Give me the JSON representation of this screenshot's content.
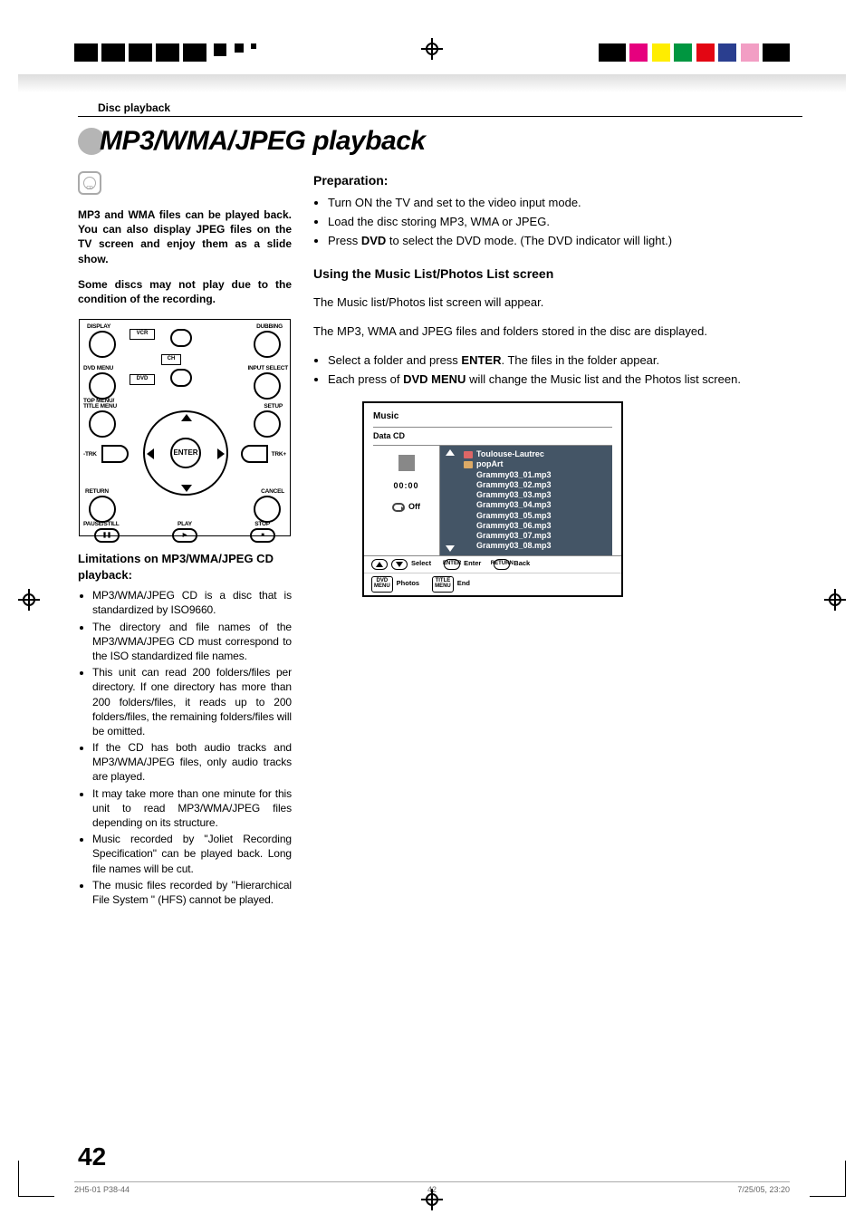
{
  "breadcrumb": "Disc playback",
  "title": "MP3/WMA/JPEG playback",
  "cd_badge": "CD",
  "left": {
    "intro1": "MP3 and WMA files can be played back. You can also display JPEG files on the TV screen and enjoy them as a slide show.",
    "intro2": "Some discs may not play due to the condition of the recording.",
    "remote": {
      "display": "DISPLAY",
      "dubbing": "DUBBING",
      "vcr": "VCR",
      "dvd": "DVD",
      "dvd_menu": "DVD MENU",
      "ch": "CH",
      "input_select": "INPUT SELECT",
      "top_menu": "TOP MENU/",
      "title_menu": "TITLE MENU",
      "setup": "SETUP",
      "trk_minus": "-TRK",
      "trk_plus": "TRK+",
      "enter": "ENTER",
      "return": "RETURN",
      "cancel": "CANCEL",
      "pause": "PAUSE/STILL",
      "play": "PLAY",
      "stop": "STOP"
    },
    "limitations_h": "Limitations on MP3/WMA/JPEG CD playback:",
    "limitations": [
      "MP3/WMA/JPEG CD is a disc that is standardized by ISO9660.",
      "The directory and file names of the MP3/WMA/JPEG CD must correspond to the ISO standardized file names.",
      "This unit can read 200 folders/files per directory. If one directory has more than 200 folders/files, it reads up to 200 folders/files, the remaining folders/files will be omitted.",
      "If the CD has both audio tracks and MP3/WMA/JPEG files, only audio tracks are played.",
      "It may take more than one minute for this unit to read MP3/WMA/JPEG files depending on its structure.",
      "Music recorded by \"Joliet Recording Specification\" can be played back. Long file names will be cut.",
      "The music files recorded by \"Hierarchical File System \" (HFS) cannot be played."
    ]
  },
  "right": {
    "prep_h": "Preparation:",
    "prep": [
      "Turn ON the TV and set to the video input mode.",
      "Load the disc storing MP3, WMA or JPEG."
    ],
    "prep3_a": "Press ",
    "prep3_b": "DVD",
    "prep3_c": " to select the DVD mode. (The DVD indicator will light.)",
    "using_h": "Using the Music List/Photos List screen",
    "p1": "The Music list/Photos list screen will appear.",
    "p2": "The MP3, WMA and JPEG files and folders stored in the disc are displayed.",
    "b1_a": "Select a folder and press ",
    "b1_b": "ENTER",
    "b1_c": ". The files in the folder appear.",
    "b2_a": "Each press of ",
    "b2_b": "DVD MENU",
    "b2_c": " will change the Music list and the Photos list screen."
  },
  "osd": {
    "title": "Music",
    "sub": "Data CD",
    "time": "00:00",
    "off": "Off",
    "folder1": "Toulouse-Lautrec",
    "folder2": "popArt",
    "files": [
      "Grammy03_01.mp3",
      "Grammy03_02.mp3",
      "Grammy03_03.mp3",
      "Grammy03_04.mp3",
      "Grammy03_05.mp3",
      "Grammy03_06.mp3",
      "Grammy03_07.mp3",
      "Grammy03_08.mp3"
    ],
    "footer": {
      "select": "Select",
      "enter_k": "ENTER",
      "enter": "Enter",
      "return_k": "RETURN",
      "back": "Back",
      "dvd_menu_k1": "DVD",
      "dvd_menu_k2": "MENU",
      "photos": "Photos",
      "title_menu_k1": "TITLE",
      "title_menu_k2": "MENU",
      "end": "End"
    }
  },
  "page_number": "42",
  "footer": {
    "a": "2H5-01 P38-44",
    "b": "42",
    "c": "7/25/05, 23:20"
  }
}
